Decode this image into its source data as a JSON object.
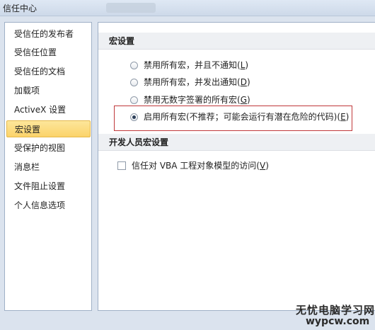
{
  "window": {
    "title": "信任中心"
  },
  "sidebar": {
    "items": [
      {
        "label": "受信任的发布者"
      },
      {
        "label": "受信任位置"
      },
      {
        "label": "受信任的文档"
      },
      {
        "label": "加载项"
      },
      {
        "label": "ActiveX 设置"
      },
      {
        "label": "宏设置",
        "selected": true
      },
      {
        "label": "受保护的视图"
      },
      {
        "label": "消息栏"
      },
      {
        "label": "文件阻止设置"
      },
      {
        "label": "个人信息选项"
      }
    ]
  },
  "macro_settings": {
    "heading": "宏设置",
    "options": [
      {
        "text": "禁用所有宏，并且不通知(",
        "key": "L",
        "suffix": ")",
        "checked": false
      },
      {
        "text": "禁用所有宏，并发出通知(",
        "key": "D",
        "suffix": ")",
        "checked": false
      },
      {
        "text": "禁用无数字签署的所有宏(",
        "key": "G",
        "suffix": ")",
        "checked": false
      },
      {
        "text": "启用所有宏(不推荐；可能会运行有潜在危险的代码)(",
        "key": "E",
        "suffix": ")",
        "checked": true
      }
    ]
  },
  "developer_settings": {
    "heading": "开发人员宏设置",
    "vba_checkbox": {
      "text": "信任对 VBA 工程对象模型的访问(",
      "key": "V",
      "suffix": ")",
      "checked": false
    }
  },
  "watermark": {
    "line1": "无忧电脑学习网",
    "line2": "wypcw.com"
  },
  "colors": {
    "selected_item": "#fbd36a",
    "highlight_border": "#c0383a"
  }
}
